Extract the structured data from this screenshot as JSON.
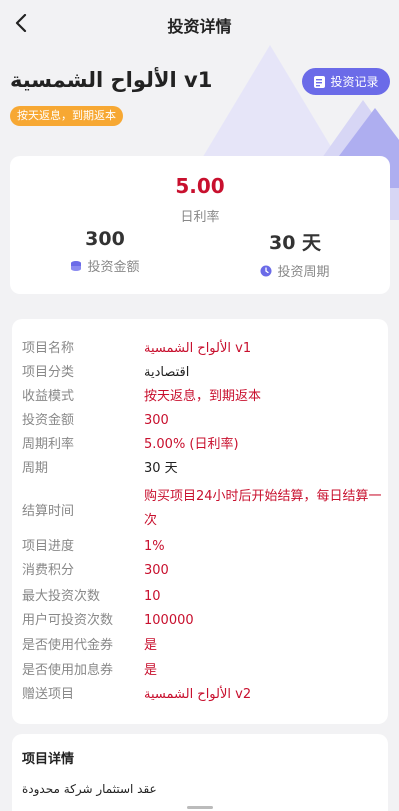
{
  "header": {
    "title": "投资详情"
  },
  "project": {
    "name": "الألواح الشمسية v1",
    "records_label": "投资记录",
    "badge": "按天返息，到期返本"
  },
  "summary": {
    "rate_value": "5.00",
    "rate_label": "日利率",
    "amount_value": "300",
    "amount_label": "投资金额",
    "period_value": "30 天",
    "period_label": "投资周期"
  },
  "details": [
    {
      "key": "项目名称",
      "value": "الألواح الشمسية v1"
    },
    {
      "key": "项目分类",
      "value": "اقتصادية"
    },
    {
      "key": "收益模式",
      "value": "按天返息，到期返本"
    },
    {
      "key": "投资金额",
      "value": "300"
    },
    {
      "key": "周期利率",
      "value": "5.00% (日利率)"
    },
    {
      "key": "周期",
      "value": "30 天"
    },
    {
      "key": "结算时间",
      "value": "购买项目24小时后开始结算，每日结算一次"
    },
    {
      "key": "项目进度",
      "value": "1%"
    },
    {
      "key": "消费积分",
      "value": "300"
    },
    {
      "key": "最大投资次数",
      "value": "10"
    },
    {
      "key": "用户可投资次数",
      "value": "100000"
    },
    {
      "key": "是否使用代金券",
      "value": "是"
    },
    {
      "key": "是否使用加息券",
      "value": "是"
    },
    {
      "key": "赠送项目",
      "value": "الألواح الشمسية v2"
    }
  ],
  "description": {
    "title": "项目详情",
    "text": "عقد استثمار شركة محدودة"
  },
  "colors": {
    "accent": "#6b6be8",
    "value_red": "#c8102e",
    "badge_orange": "#f7a833"
  }
}
